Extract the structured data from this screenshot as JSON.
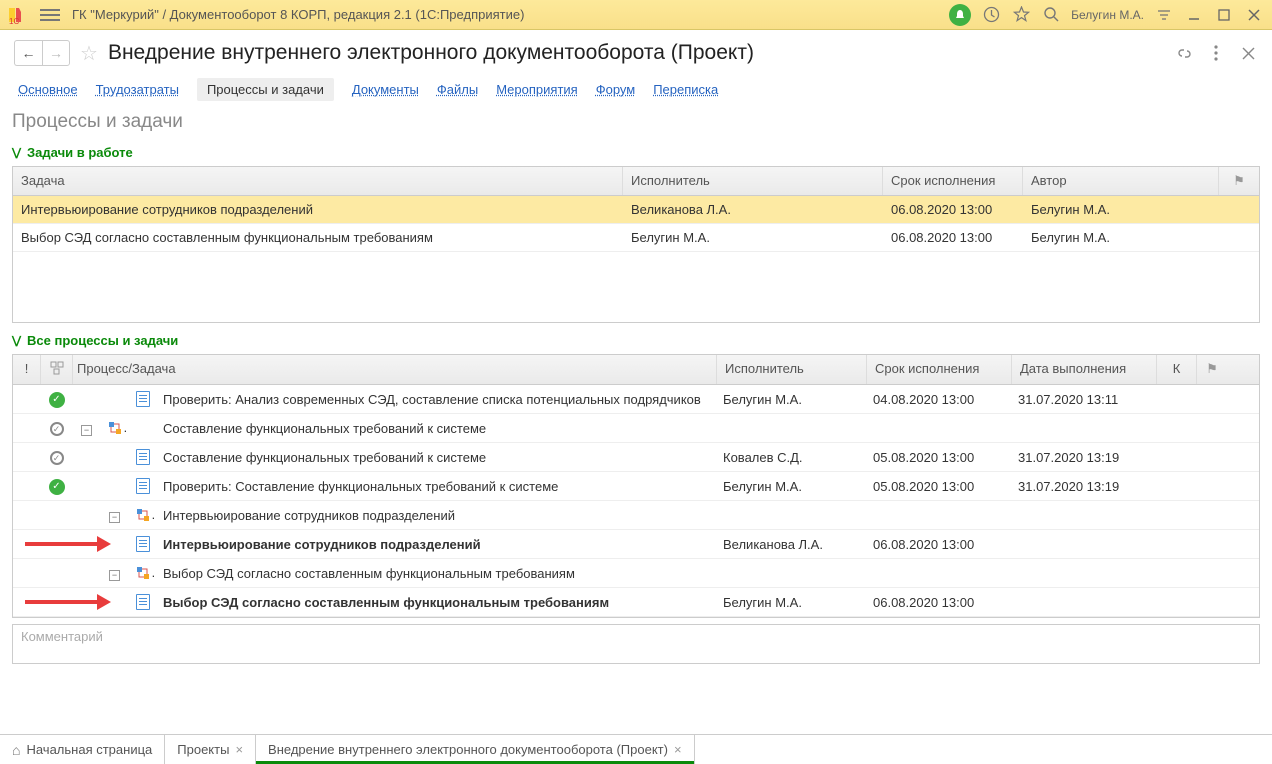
{
  "titlebar": {
    "text": "ГК \"Меркурий\" / Документооборот 8 КОРП, редакция 2.1  (1С:Предприятие)",
    "user": "Белугин М.А."
  },
  "header": {
    "title": "Внедрение внутреннего электронного документооборота (Проект)"
  },
  "tabs": {
    "items": [
      "Основное",
      "Трудозатраты",
      "Процессы и задачи",
      "Документы",
      "Файлы",
      "Мероприятия",
      "Форум",
      "Переписка"
    ],
    "active_index": 2
  },
  "section_title": "Процессы и задачи",
  "sect1": {
    "caption": "Задачи в работе",
    "columns": {
      "task": "Задача",
      "executor": "Исполнитель",
      "due": "Срок исполнения",
      "author": "Автор"
    },
    "rows": [
      {
        "task": "Интервьюирование сотрудников подразделений",
        "executor": "Великанова Л.А.",
        "due": "06.08.2020 13:00",
        "author": "Белугин М.А.",
        "selected": true
      },
      {
        "task": "Выбор СЭД согласно составленным функциональным требованиям",
        "executor": "Белугин М.А.",
        "due": "06.08.2020 13:00",
        "author": "Белугин М.А.",
        "selected": false
      }
    ]
  },
  "sect2": {
    "caption": "Все процессы и задачи",
    "columns": {
      "name": "Процесс/Задача",
      "executor": "Исполнитель",
      "due": "Срок исполнения",
      "done": "Дата выполнения",
      "k": "К"
    },
    "rows": [
      {
        "status": "green",
        "toggle": "",
        "typeicon": "doc",
        "name": "Проверить: Анализ современных СЭД, составление списка потенциальных подрядчиков",
        "executor": "Белугин М.А.",
        "due": "04.08.2020 13:00",
        "done": "31.07.2020 13:11",
        "bold": false,
        "arrow": false,
        "indent": 2
      },
      {
        "status": "gray",
        "toggle": "−",
        "typeicon": "proc",
        "name": "Составление функциональных требований к системе",
        "executor": "",
        "due": "",
        "done": "",
        "bold": false,
        "arrow": false,
        "indent": 0
      },
      {
        "status": "gray",
        "toggle": "",
        "typeicon": "doc",
        "name": "Составление функциональных требований к системе",
        "executor": "Ковалев С.Д.",
        "due": "05.08.2020 13:00",
        "done": "31.07.2020 13:19",
        "bold": false,
        "arrow": false,
        "indent": 2
      },
      {
        "status": "green",
        "toggle": "",
        "typeicon": "doc",
        "name": "Проверить: Составление функциональных требований к системе",
        "executor": "Белугин М.А.",
        "due": "05.08.2020 13:00",
        "done": "31.07.2020 13:19",
        "bold": false,
        "arrow": false,
        "indent": 2
      },
      {
        "status": "",
        "toggle": "−",
        "typeicon": "proc",
        "name": "Интервьюирование сотрудников подразделений",
        "executor": "",
        "due": "",
        "done": "",
        "bold": false,
        "arrow": false,
        "indent": 1
      },
      {
        "status": "",
        "toggle": "",
        "typeicon": "doc",
        "name": "Интервьюирование сотрудников подразделений",
        "executor": "Великанова Л.А.",
        "due": "06.08.2020 13:00",
        "done": "",
        "bold": true,
        "arrow": true,
        "indent": 2
      },
      {
        "status": "",
        "toggle": "−",
        "typeicon": "proc",
        "name": "Выбор СЭД согласно составленным функциональным требованиям",
        "executor": "",
        "due": "",
        "done": "",
        "bold": false,
        "arrow": false,
        "indent": 1
      },
      {
        "status": "",
        "toggle": "",
        "typeicon": "doc",
        "name": "Выбор СЭД согласно составленным функциональным требованиям",
        "executor": "Белугин М.А.",
        "due": "06.08.2020 13:00",
        "done": "",
        "bold": true,
        "arrow": true,
        "indent": 2
      }
    ]
  },
  "comment": {
    "placeholder": "Комментарий"
  },
  "bottom_tabs": {
    "items": [
      {
        "label": "Начальная страница",
        "closable": false,
        "icon": "home"
      },
      {
        "label": "Проекты",
        "closable": true
      },
      {
        "label": "Внедрение внутреннего электронного документооборота (Проект)",
        "closable": true,
        "active": true
      }
    ]
  }
}
